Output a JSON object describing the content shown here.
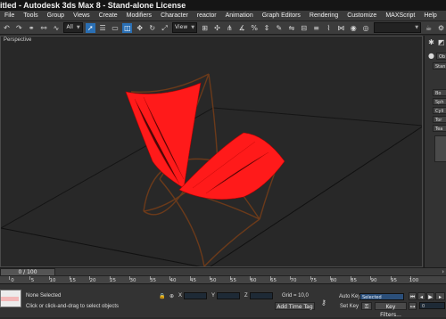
{
  "titlebar": {
    "title": "itled - Autodesk 3ds Max 8   - Stand-alone License"
  },
  "menu": [
    "File",
    "Tools",
    "Group",
    "Views",
    "Create",
    "Modifiers",
    "Character",
    "reactor",
    "Animation",
    "Graph Editors",
    "Rendering",
    "Customize",
    "MAXScript",
    "Help"
  ],
  "toolbar": {
    "selection_filter": "All",
    "reference_coord": "View"
  },
  "viewport": {
    "label": "Perspective"
  },
  "command_panel": {
    "items": [
      "Ob",
      "Stan",
      "Bo",
      "Sph",
      "Cyli",
      "Tor",
      "Tea"
    ]
  },
  "timeline": {
    "frame_label": "0 / 100"
  },
  "ruler": {
    "ticks": [
      "0",
      "5",
      "10",
      "15",
      "20",
      "25",
      "30",
      "35",
      "40",
      "45",
      "50",
      "55",
      "60",
      "65",
      "70",
      "75",
      "80",
      "85",
      "90",
      "95",
      "100"
    ]
  },
  "status": {
    "selection": "None Selected",
    "prompt": "Click or click-and-drag to select objects",
    "x_label": "X",
    "y_label": "Y",
    "z_label": "Z",
    "grid": "Grid = 10,0",
    "add_time_tag": "Add Time Tag",
    "auto_key": "Auto Key",
    "auto_key_dropdown": "Selected",
    "set_key": "Set Key",
    "key_filters": "Key Filters...",
    "frame_field": "0"
  },
  "colors": {
    "chair_fabric": "#ff1a1a",
    "chair_frame": "#6b3a1a",
    "active_tool": "#2a6fb4"
  }
}
